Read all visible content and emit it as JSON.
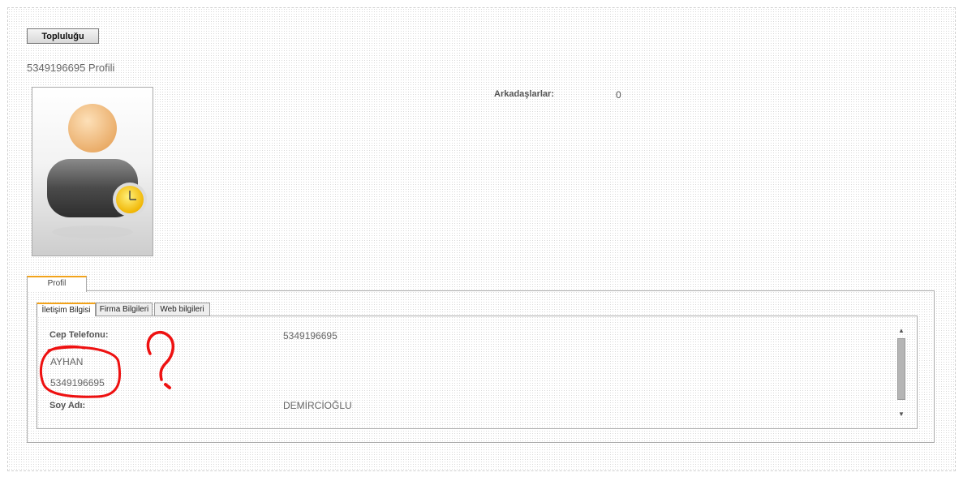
{
  "toolbar": {
    "community_label": "Topluluğu"
  },
  "profile": {
    "title": "5349196695 Profili",
    "friends_label": "Arkadaşlarlar:",
    "friends_count": "0",
    "avatar_icon": "user-clock-icon"
  },
  "tabs": {
    "main": "Profil"
  },
  "subtabs": [
    "İletişim Bilgisi",
    "Firma Bilgileri",
    "Web bilgileri"
  ],
  "fields": {
    "phone_label": "Cep Telefonu:",
    "phone_value": "5349196695",
    "name_value": "AYHAN",
    "phone_value_2": "5349196695",
    "surname_label": "Soy Adı:",
    "surname_value": "DEMİRCİOĞLU"
  },
  "annotation": {
    "color": "#ee1111",
    "mark": "question-mark"
  },
  "colors": {
    "tab_accent": "#f2a31b"
  }
}
